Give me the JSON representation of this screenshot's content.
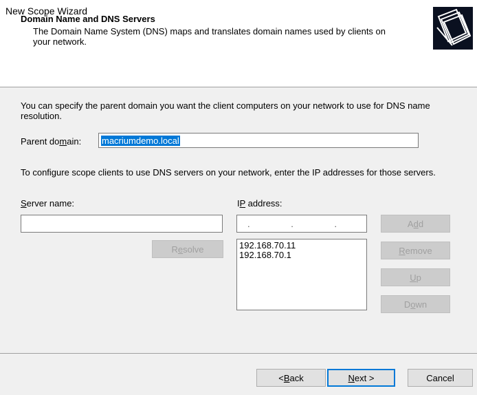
{
  "window": {
    "title": "New Scope Wizard"
  },
  "header": {
    "title": "Domain Name and DNS Servers",
    "description": "The Domain Name System (DNS) maps and translates domain names used by clients on your network."
  },
  "body": {
    "intro": "You can specify the parent domain you want the client computers on your network to use for DNS name resolution.",
    "parent_domain_label_pre": "Parent do",
    "parent_domain_label_u": "m",
    "parent_domain_label_post": "ain:",
    "parent_domain_value": "macriumdemo.local",
    "dns_intro": "To configure scope clients to use DNS servers on your network, enter the IP addresses for those servers.",
    "server_name_label_u": "S",
    "server_name_label_post": "erver name:",
    "ip_label_pre": "I",
    "ip_label_u": "P",
    "ip_label_post": " address:",
    "ip_placeholder": ". . .",
    "resolve_u": "e",
    "resolve_pre": "R",
    "resolve_post": "solve",
    "dns_list": [
      "192.168.70.11",
      "192.168.70.1"
    ],
    "buttons": {
      "add_pre": "A",
      "add_u": "d",
      "add_post": "d",
      "remove_u": "R",
      "remove_post": "emove",
      "up_u": "U",
      "up_post": "p",
      "down_pre": "D",
      "down_u": "o",
      "down_post": "wn"
    }
  },
  "footer": {
    "back_pre": "< ",
    "back_u": "B",
    "back_post": "ack",
    "next_u": "N",
    "next_post": "ext >",
    "cancel": "Cancel"
  },
  "colors": {
    "selection": "#0078d7",
    "window_bg": "#f0f0f0",
    "header_bg": "#ffffff"
  }
}
